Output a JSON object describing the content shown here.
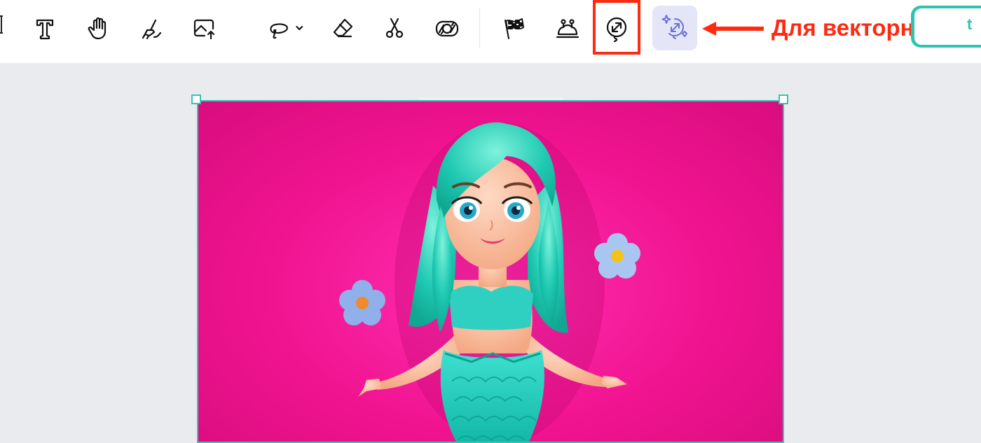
{
  "toolbar": {
    "tools": [
      {
        "name": "text-tool",
        "icon": "text-icon"
      },
      {
        "name": "hand-tool",
        "icon": "hand-icon"
      },
      {
        "name": "brush-tool",
        "icon": "brush-icon"
      },
      {
        "name": "upload-tool",
        "icon": "image-upload-icon"
      },
      {
        "name": "lasso-tool",
        "icon": "lasso-icon"
      },
      {
        "name": "eraser-tool",
        "icon": "eraser-icon"
      },
      {
        "name": "cut-tool",
        "icon": "scissors-icon"
      },
      {
        "name": "remove-bg-tool",
        "icon": "remove-background-icon"
      },
      {
        "name": "flag-tool",
        "icon": "checkered-flag-icon"
      },
      {
        "name": "mask-tool",
        "icon": "face-mask-icon"
      },
      {
        "name": "resize-tool",
        "icon": "resize-balloon-icon"
      },
      {
        "name": "ai-vectorize-tool",
        "icon": "ai-vector-icon"
      }
    ],
    "export_label": "t"
  },
  "annotation": {
    "text": "Для векторных",
    "color": "#ff2a10"
  },
  "canvas": {
    "image": "mermaid-doll-icon",
    "background_color": "#f0138f",
    "selection_color": "#38c4b6"
  },
  "colors": {
    "accent": "#2ec4b0",
    "ai_tool_bg": "#e4e6f8",
    "ai_tool_icon": "#6b6fd8"
  }
}
